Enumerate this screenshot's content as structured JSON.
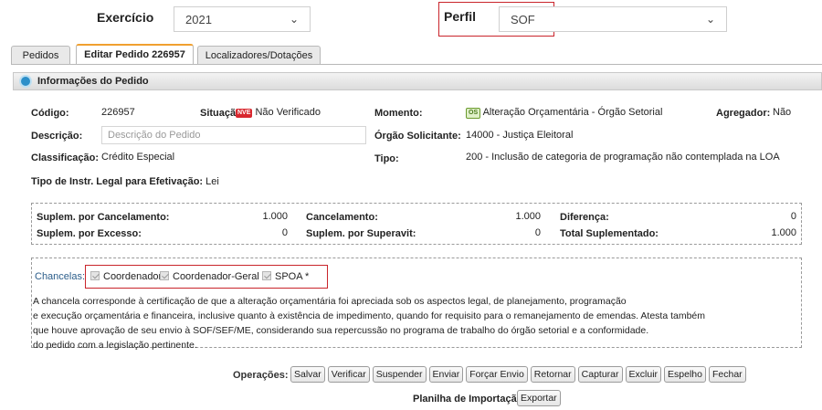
{
  "filters": {
    "exercicio_label": "Exercício",
    "exercicio_value": "2021",
    "perfil_label": "Perfil",
    "perfil_value": "SOF"
  },
  "tabs": [
    {
      "label": "Pedidos"
    },
    {
      "label": "Editar Pedido 226957"
    },
    {
      "label": "Localizadores/Dotações"
    }
  ],
  "panel": {
    "title": "Informações do Pedido",
    "codigo_label": "Código:",
    "codigo_value": "226957",
    "situacao_label": "Situação:",
    "situacao_badge": "NVE",
    "situacao_value": "Não Verificado",
    "momento_label": "Momento:",
    "momento_badge": "OS",
    "momento_value": "Alteração Orçamentária - Órgão Setorial",
    "agregador_label": "Agregador:",
    "agregador_value": "Não",
    "descricao_label": "Descrição:",
    "descricao_placeholder": "Descrição do Pedido",
    "orgao_label": "Órgão Solicitante:",
    "orgao_value": "14000 - Justiça Eleitoral",
    "classificacao_label": "Classificação:",
    "classificacao_value": "Crédito Especial",
    "tipo_label": "Tipo:",
    "tipo_value": "200 - Inclusão de categoria de programação não contemplada na LOA",
    "instr_label": "Tipo de Instr. Legal para Efetivação:",
    "instr_value": "Lei"
  },
  "totals": {
    "supl_cancel_label": "Suplem. por Cancelamento:",
    "supl_cancel_value": "1.000",
    "cancel_label": "Cancelamento:",
    "cancel_value": "1.000",
    "diferenca_label": "Diferença:",
    "diferenca_value": "0",
    "supl_excesso_label": "Suplem. por Excesso:",
    "supl_excesso_value": "0",
    "supl_superavit_label": "Suplem. por Superavit:",
    "supl_superavit_value": "0",
    "total_label": "Total Suplementado:",
    "total_value": "1.000"
  },
  "chancelas": {
    "label": "Chancelas:",
    "items": [
      "Coordenador",
      "Coordenador-Geral *",
      "SPOA *"
    ],
    "text": [
      "A chancela corresponde à certificação de que a alteração orçamentária foi apreciada sob os aspectos legal, de planejamento, programação",
      "e execução orçamentária e financeira, inclusive quanto à existência de impedimento, quando for requisito para o remanejamento de emendas. Atesta também",
      "que houve aprovação de seu envio à SOF/SEF/ME, considerando sua repercussão no programa de trabalho do órgão setorial e a conformidade.",
      "do pedido com a legislação pertinente."
    ]
  },
  "operations": {
    "label": "Operações:",
    "buttons": [
      "Salvar",
      "Verificar",
      "Suspender",
      "Enviar",
      "Forçar Envio",
      "Retornar",
      "Capturar",
      "Excluir",
      "Espelho",
      "Fechar"
    ],
    "import_label": "Planilha de Importação:",
    "export_button": "Exportar"
  },
  "colors": {
    "highlight_red": "#c9242b",
    "active_tab_accent": "#f0a030",
    "info_icon": "#2d8fc9"
  }
}
